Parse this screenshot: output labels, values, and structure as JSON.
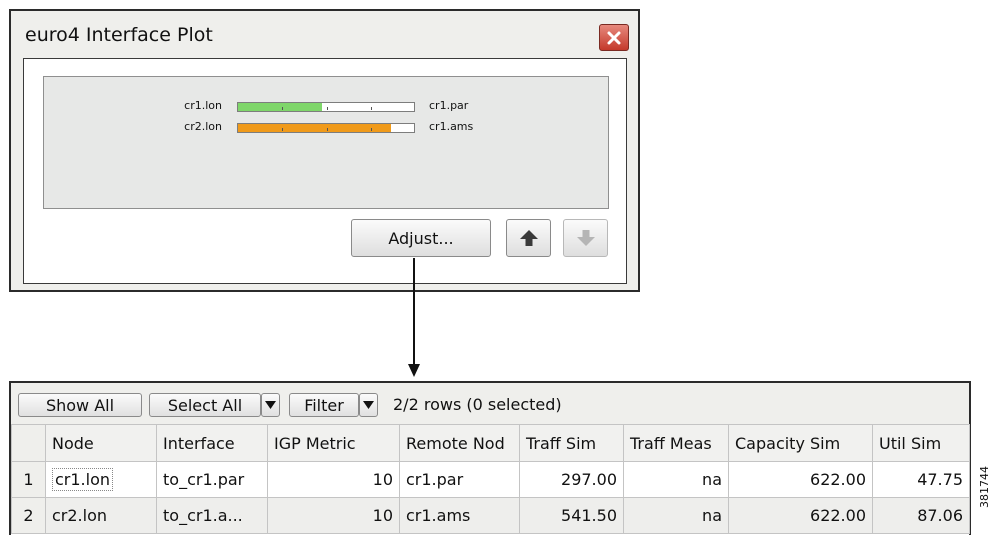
{
  "dialog": {
    "title": "euro4 Interface Plot",
    "close_icon": "close-icon",
    "plot": {
      "rows": [
        {
          "node": "cr1.lon",
          "remote": "cr1.par",
          "utilization_percent": 47.75,
          "color": "#7fd66a"
        },
        {
          "node": "cr2.lon",
          "remote": "cr1.ams",
          "utilization_percent": 87.06,
          "color": "#f09a1a"
        }
      ]
    },
    "buttons": {
      "adjust": "Adjust...",
      "up_icon": "arrow-up-icon",
      "down_icon": "arrow-down-icon"
    }
  },
  "table_panel": {
    "toolbar": {
      "show_all": "Show All",
      "select_all": "Select All",
      "filter": "Filter",
      "rows_status": "2/2 rows (0 selected)"
    },
    "columns": [
      "Node",
      "Interface",
      "IGP Metric",
      "Remote Nod",
      "Traff Sim",
      "Traff Meas",
      "Capacity Sim",
      "Util Sim"
    ],
    "rows": [
      {
        "num": "1",
        "node": "cr1.lon",
        "interface": "to_cr1.par",
        "igp_metric": "10",
        "remote_node": "cr1.par",
        "traff_sim": "297.00",
        "traff_meas": "na",
        "capacity_sim": "622.00",
        "util_sim": "47.75"
      },
      {
        "num": "2",
        "node": "cr2.lon",
        "interface": "to_cr1.a...",
        "igp_metric": "10",
        "remote_node": "cr1.ams",
        "traff_sim": "541.50",
        "traff_meas": "na",
        "capacity_sim": "622.00",
        "util_sim": "87.06"
      }
    ]
  },
  "figure_id": "381744"
}
